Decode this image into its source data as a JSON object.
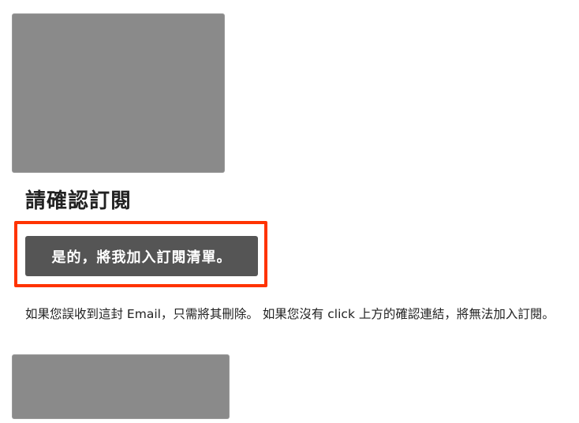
{
  "header_image": {
    "icon": "redacted-image"
  },
  "title": "請確認訂閱",
  "confirm_button": {
    "label": "是的，將我加入訂閱清單。"
  },
  "highlight": {
    "color": "#ff3300"
  },
  "notice": "如果您誤收到這封 Email，只需將其刪除。 如果您沒有 click 上方的確認連結，將無法加入訂閱。",
  "footer_image": {
    "icon": "redacted-image"
  },
  "colors": {
    "button_bg": "#555555",
    "button_text": "#ffffff",
    "text": "#222222",
    "redaction": "#8a8a8a"
  }
}
